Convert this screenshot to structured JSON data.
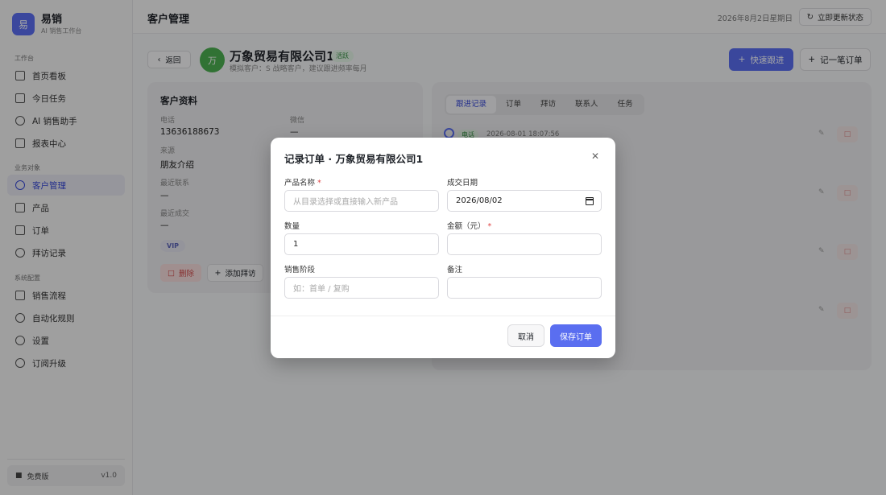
{
  "brand": {
    "logo_char": "易",
    "name": "易销",
    "subtitle": "AI 销售工作台"
  },
  "sidebar": {
    "sections": [
      {
        "title": "工作台",
        "items": [
          "首页看板",
          "今日任务",
          "AI 销售助手",
          "报表中心"
        ]
      },
      {
        "title": "业务对象",
        "items": [
          "客户管理",
          "产品",
          "订单",
          "拜访记录"
        ]
      },
      {
        "title": "系统配置",
        "items": [
          "销售流程",
          "自动化规则",
          "设置",
          "订阅升级"
        ]
      }
    ],
    "active_item": "客户管理",
    "plan_label": "免费版",
    "version": "v1.0"
  },
  "header": {
    "title": "客户管理",
    "date": "2026年8月2日星期日",
    "refresh_label": "立即更新状态"
  },
  "customer": {
    "back_label": "返回",
    "avatar_char": "万",
    "name": "万象贸易有限公司1",
    "status": "活跃",
    "subtitle": "模拟客户：S 战略客户，建议跟进频率每月",
    "quick_follow_label": "快速跟进",
    "record_order_label": "记一笔订单"
  },
  "profile": {
    "title": "客户资料",
    "fields": {
      "phone_label": "电话",
      "phone_value": "13636188673",
      "wechat_label": "微信",
      "wechat_value": "—",
      "source_label": "来源",
      "source_value": "朋友介绍",
      "last_contact_label": "最近联系",
      "last_contact_value": "—",
      "last_deal_label": "最近成交",
      "last_deal_value": "—"
    },
    "tag": "VIP",
    "delete_label": "删除",
    "add_visit_label": "添加拜访"
  },
  "records": {
    "tabs": [
      "跟进记录",
      "订单",
      "拜访",
      "联系人",
      "任务"
    ],
    "active_tab": "跟进记录",
    "first": {
      "type": "电话",
      "time": "2026-08-01 18:07:56"
    }
  },
  "modal": {
    "title": "记录订单 · 万象贸易有限公司1",
    "product_label": "产品名称",
    "product_placeholder": "从目录选择或直接输入新产品",
    "date_label": "成交日期",
    "date_value": "2026/08/02",
    "qty_label": "数量",
    "qty_value": "1",
    "amount_label": "金额（元）",
    "amount_value": "",
    "stage_label": "销售阶段",
    "stage_placeholder": "如：首单 / 复购",
    "note_label": "备注",
    "note_value": "",
    "cancel_label": "取消",
    "save_label": "保存订单"
  }
}
